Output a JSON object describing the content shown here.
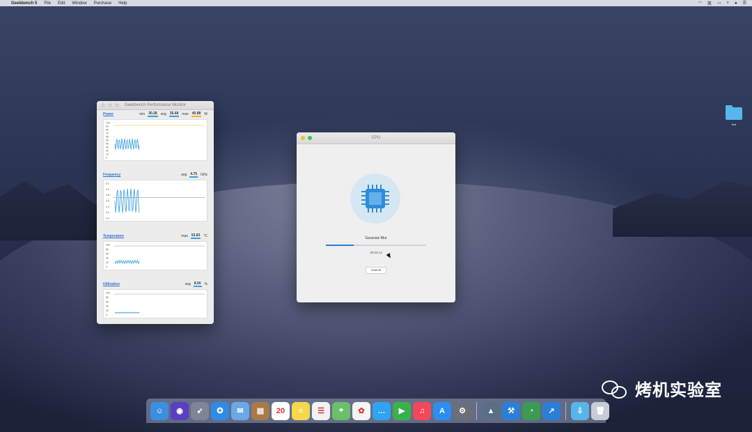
{
  "menubar": {
    "app_name": "Geekbench 5",
    "items": [
      "File",
      "Edit",
      "Window",
      "Purchase",
      "Help"
    ],
    "right_glyph": "英"
  },
  "monitor_window": {
    "title": "Geekbench Performance Monitor",
    "panels": [
      {
        "name": "Power",
        "stats": [
          {
            "label": "min",
            "value": "30.28"
          },
          {
            "label": "avg",
            "value": "35.68"
          },
          {
            "label": "max",
            "value": "40.88"
          }
        ],
        "unit": "W",
        "y_ticks": [
          "100",
          "90",
          "80",
          "70",
          "60",
          "50",
          "40",
          "30",
          "20",
          "10",
          "0"
        ]
      },
      {
        "name": "Frequency",
        "stats": [
          {
            "label": "avg",
            "value": "4.75"
          }
        ],
        "unit": "GHz",
        "y_ticks": [
          "5.2",
          "5.0",
          "4.8",
          "4.6",
          "4.4",
          "4.2",
          "4.0"
        ]
      },
      {
        "name": "Temperature",
        "stats": [
          {
            "label": "max",
            "value": "53.83"
          }
        ],
        "unit": "°C",
        "y_ticks": [
          "100",
          "80",
          "60",
          "40",
          "20",
          "0"
        ]
      },
      {
        "name": "Utilization",
        "stats": [
          {
            "label": "avg",
            "value": "8.00"
          }
        ],
        "unit": "%",
        "y_ticks": [
          "100",
          "80",
          "60",
          "40",
          "20",
          "0"
        ]
      }
    ]
  },
  "cpu_window": {
    "title": "CPU",
    "task": "Gaussian Blur",
    "progress": 0.28,
    "elapsed": "00:00:14",
    "cancel_label": "Cancel"
  },
  "desktop_folder": {
    "label": "test"
  },
  "watermark": {
    "text": "烤机实验室"
  },
  "dock": {
    "items": [
      {
        "icon": "finder-icon",
        "color": "#3b8fe0",
        "glyph": "☺"
      },
      {
        "icon": "siri-icon",
        "color": "#5a3fc0",
        "glyph": "◉"
      },
      {
        "icon": "launchpad-icon",
        "color": "#7d8597",
        "glyph": "➶"
      },
      {
        "icon": "safari-icon",
        "color": "#2f8ae8",
        "glyph": "✪"
      },
      {
        "icon": "mail-icon",
        "color": "#6aa8e8",
        "glyph": "✉"
      },
      {
        "icon": "contacts-icon",
        "color": "#a87a4a",
        "glyph": "▤"
      },
      {
        "icon": "calendar-icon",
        "color": "#ffffff",
        "glyph": "20"
      },
      {
        "icon": "notes-icon",
        "color": "#f6d84a",
        "glyph": "≡"
      },
      {
        "icon": "reminders-icon",
        "color": "#f2f2f2",
        "glyph": "☰"
      },
      {
        "icon": "maps-icon",
        "color": "#6cbf6a",
        "glyph": "⌖"
      },
      {
        "icon": "photos-icon",
        "color": "#f4f4f4",
        "glyph": "✿"
      },
      {
        "icon": "messages-icon",
        "color": "#2ea4f2",
        "glyph": "…"
      },
      {
        "icon": "facetime-icon",
        "color": "#38b24a",
        "glyph": "▶"
      },
      {
        "icon": "music-icon",
        "color": "#f4475b",
        "glyph": "♫"
      },
      {
        "icon": "app-store-icon",
        "color": "#2b8ef0",
        "glyph": "A"
      },
      {
        "icon": "system-preferences-icon",
        "color": "#6b6f78",
        "glyph": "⚙"
      },
      {
        "sep": true
      },
      {
        "icon": "geekbench-icon",
        "color": "#5a6e85",
        "glyph": "▲"
      },
      {
        "icon": "xcode-icon",
        "color": "#2c7fd8",
        "glyph": "⚒"
      },
      {
        "icon": "activity-monitor-icon",
        "color": "#3c9a52",
        "glyph": "◔"
      },
      {
        "icon": "stocks-icon",
        "color": "#2b7ed8",
        "glyph": "↗"
      },
      {
        "sep": true
      },
      {
        "icon": "downloads-folder-icon",
        "color": "#58b4ec",
        "glyph": "⇩"
      },
      {
        "icon": "trash-icon",
        "color": "#c8ccd4",
        "glyph": "🗑"
      }
    ]
  }
}
